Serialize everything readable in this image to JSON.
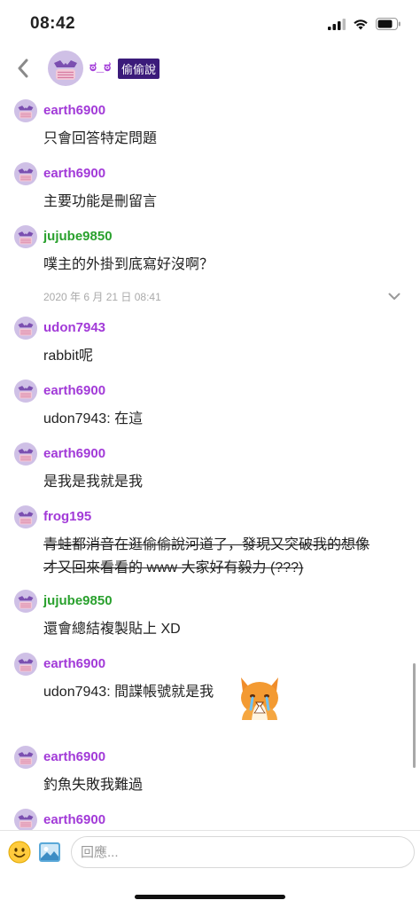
{
  "status_bar": {
    "time": "08:42"
  },
  "header": {
    "title": "ಠ_ಠ",
    "badge": "偷偷說",
    "back_icon": "chevron-left-icon"
  },
  "colors": {
    "purple_user": "#a23ad8",
    "green_user": "#2aa12e",
    "badge_bg": "#3b1b7a"
  },
  "messages": [
    {
      "user": "earth6900",
      "text": "只會回答特定問題"
    },
    {
      "user": "earth6900",
      "text": "主要功能是刪留言"
    },
    {
      "user": "jujube9850",
      "text": "噗主的外掛到底寫好沒啊？",
      "timestamp": "2020 年 6 月 21 日 08:41"
    },
    {
      "user": "udon7943",
      "text": "rabbit呢"
    },
    {
      "user": "earth6900",
      "text": "udon7943: 在這"
    },
    {
      "user": "earth6900",
      "text": "是我是我就是我"
    },
    {
      "user": "frog195",
      "text_line1": "青蛙都消音在逛偷偷說河道了，發現又突破我的想像",
      "text_line2": "才又回來看看的 www 大家好有毅力 (???)"
    },
    {
      "user": "jujube9850",
      "text": "還會總結複製貼上 XD"
    },
    {
      "user": "earth6900",
      "text": "udon7943: 間諜帳號就是我"
    },
    {
      "user": "earth6900",
      "text": "釣魚失敗我難過"
    },
    {
      "user": "earth6900",
      "text": ""
    }
  ],
  "composer": {
    "placeholder": "回應..."
  }
}
